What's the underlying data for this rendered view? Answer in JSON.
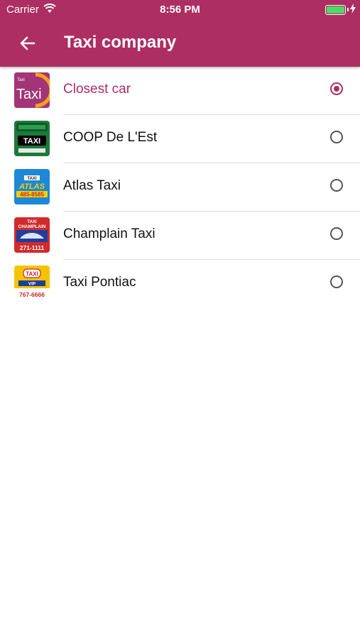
{
  "status_bar": {
    "carrier": "Carrier",
    "time": "8:56 PM"
  },
  "header": {
    "title": "Taxi company"
  },
  "companies": [
    {
      "label": "Closest car",
      "logo_text": "Taxi",
      "logo_small": "Taxi",
      "selected": true,
      "logo_colors": [
        "#a23577",
        "#f7a11b"
      ]
    },
    {
      "label": "COOP De L'Est",
      "logo_text": "TAXI",
      "selected": false,
      "logo_colors": [
        "#1b7a3a",
        "#000000"
      ]
    },
    {
      "label": "Atlas Taxi",
      "logo_text": "ATLAS",
      "logo_small": "TAXI",
      "logo_phone": "485-8585",
      "selected": false,
      "logo_colors": [
        "#1e88d6",
        "#f5d000"
      ]
    },
    {
      "label": "Champlain Taxi",
      "logo_text": "CHAMPLAIN",
      "logo_small": "TAXI",
      "logo_phone": "271-1111",
      "selected": false,
      "logo_colors": [
        "#d12b2b",
        "#1d3f9b"
      ]
    },
    {
      "label": "Taxi Pontiac",
      "logo_text": "TAXI",
      "logo_small": "VIP",
      "logo_phone": "767-6666",
      "selected": false,
      "logo_colors": [
        "#f5c400",
        "#c62828"
      ]
    }
  ],
  "theme": {
    "accent": "#ad2e62"
  }
}
